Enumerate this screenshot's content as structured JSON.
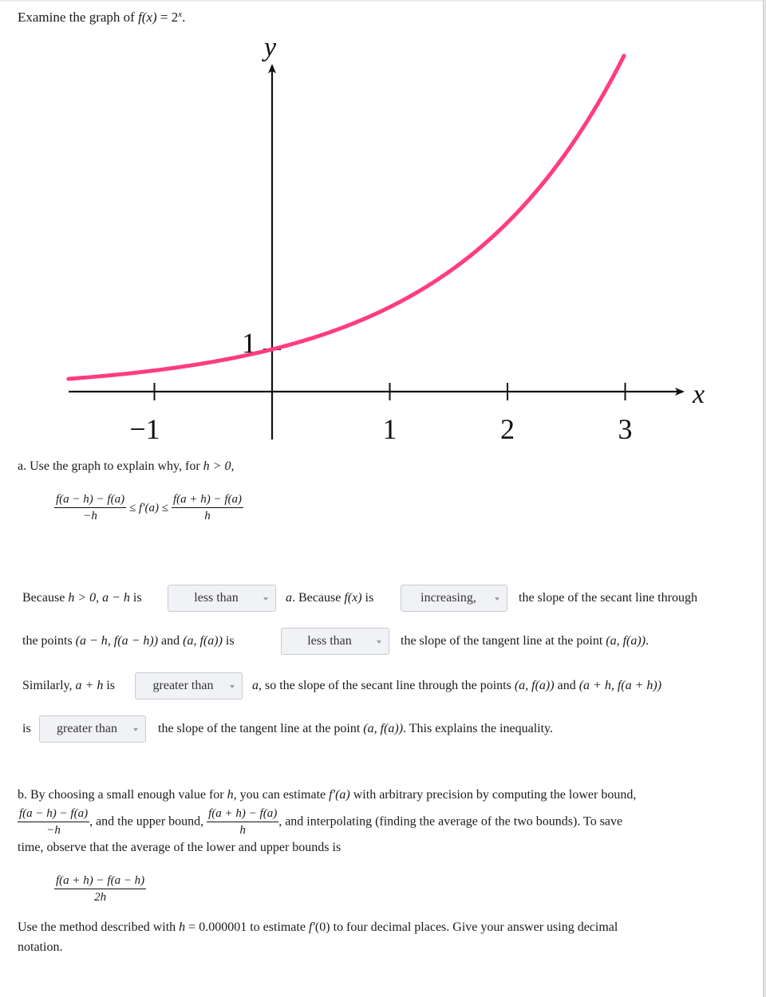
{
  "intro": {
    "prefix": "Examine the graph of ",
    "func_lhs": "f(x)",
    "equals": " = 2",
    "exponent": "x",
    "suffix": "."
  },
  "chart_data": {
    "type": "line",
    "title": "",
    "function": "2^x",
    "xlabel": "x",
    "ylabel": "y",
    "xlim": [
      -2.1,
      3.3
    ],
    "ylim": [
      0,
      8.3
    ],
    "x_ticks": [
      -1,
      1,
      2,
      3
    ],
    "x_tick_labels": [
      "−1",
      "1",
      "2",
      "3"
    ],
    "y_ticks": [
      1
    ],
    "y_tick_labels": [
      "1"
    ],
    "series": [
      {
        "name": "f(x) = 2^x",
        "color": "#ff3d7f",
        "x": [
          -1.7,
          -1.5,
          -1.0,
          -0.5,
          0.0,
          0.5,
          1.0,
          1.5,
          2.0,
          2.5,
          3.0
        ],
        "y": [
          0.31,
          0.35,
          0.5,
          0.71,
          1.0,
          1.41,
          2.0,
          2.83,
          4.0,
          5.66,
          8.0
        ]
      }
    ],
    "x_range_plotted": [
      -1.73,
      2.99
    ],
    "grid": false,
    "legend": "none"
  },
  "part_a": {
    "prompt": "a. Use the graph to explain why, for ",
    "cond": "h > 0,",
    "ineq_left_num": "f(a − h) − f(a)",
    "ineq_left_den": "−h",
    "ineq_mid": "≤ f′(a) ≤",
    "ineq_right_num": "f(a + h) − f(a)",
    "ineq_right_den": "h"
  },
  "sentences": {
    "s1_a": "Because ",
    "s1_b": "h > 0, a − h",
    "s1_c": " is",
    "s1_d": "a",
    "s1_e": ". Because ",
    "s1_f": "f(x)",
    "s1_g": " is",
    "s1_h": "the slope of the secant line through",
    "s2_a": "the points ",
    "s2_b": "(a − h, f(a − h))",
    "s2_c": " and ",
    "s2_d": "(a, f(a))",
    "s2_e": " is",
    "s2_f": "the slope of the tangent line at the point ",
    "s2_g": "(a, f(a))",
    "s2_h": ".",
    "s3_a": "Similarly, ",
    "s3_b": "a + h",
    "s3_c": " is",
    "s3_d": "a",
    "s3_e": ", so the slope of the secant line through the points ",
    "s3_f": "(a, f(a))",
    "s3_g": " and ",
    "s3_h": "(a + h, f(a + h))",
    "s4_a": "is",
    "s4_b": "the slope of the tangent line at the point ",
    "s4_c": "(a, f(a))",
    "s4_d": ". This explains the inequality."
  },
  "dropdowns": [
    {
      "selected": "less than"
    },
    {
      "selected": "increasing,"
    },
    {
      "selected": "less than"
    },
    {
      "selected": "greater than"
    },
    {
      "selected": "greater than"
    }
  ],
  "part_b": {
    "l1_a": "b. By choosing a small enough value for ",
    "l1_b": "h",
    "l1_c": ", you can estimate ",
    "l1_d": "f′(a)",
    "l1_e": " with arbitrary precision by computing the lower bound,",
    "lower_num": "f(a − h) − f(a)",
    "lower_den": "−h",
    "l2_a": ", and the upper bound, ",
    "upper_num": "f(a + h) − f(a)",
    "upper_den": "h",
    "l2_b": ", and interpolating (finding the average of the two bounds). To save",
    "l3": "time, observe that the average of the lower and upper bounds is",
    "avg_num": "f(a + h) − f(a − h)",
    "avg_den": "2h",
    "final_a": "Use the method described with ",
    "final_b": "h",
    "final_c": " = 0.000001 to estimate ",
    "final_d": "f′",
    "final_e": "(0) to four decimal places. Give your answer using decimal",
    "final_f": "notation."
  }
}
